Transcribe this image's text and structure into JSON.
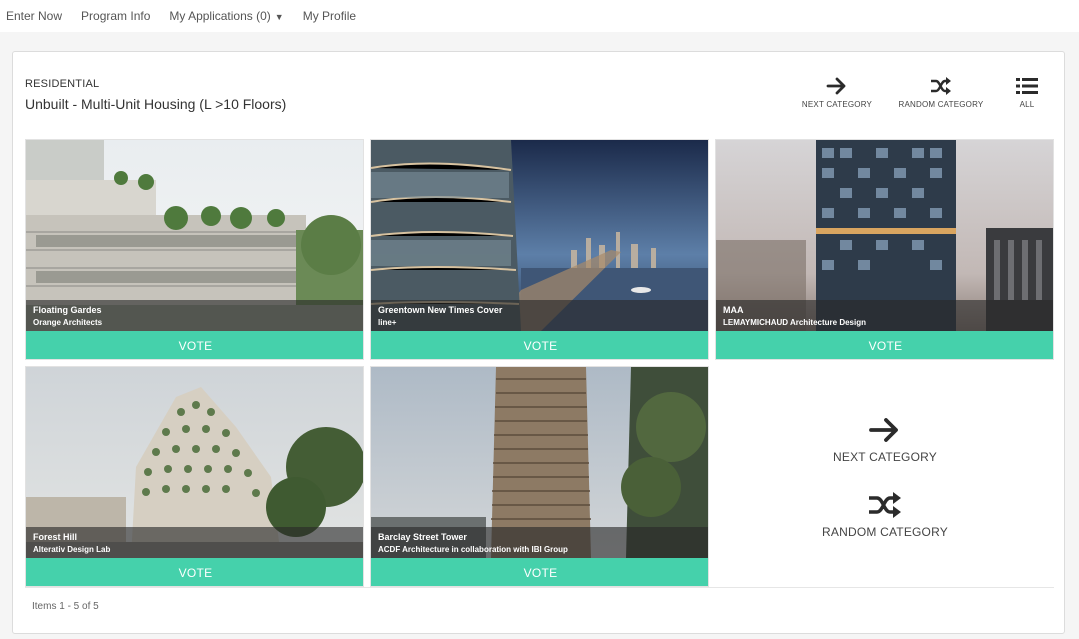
{
  "nav": {
    "enter_now": "Enter Now",
    "program_info": "Program Info",
    "my_applications": "My Applications (0)",
    "my_profile": "My Profile"
  },
  "category": {
    "label": "RESIDENTIAL",
    "title": "Unbuilt - Multi-Unit Housing (L >10 Floors)"
  },
  "toolbar": {
    "next_category": "NEXT CATEGORY",
    "random_category": "RANDOM CATEGORY",
    "all": "ALL"
  },
  "entries": [
    {
      "title": "Floating Gardes",
      "firm": "Orange Architects",
      "vote": "VOTE"
    },
    {
      "title": "Greentown New Times Cover",
      "firm": "line+",
      "vote": "VOTE"
    },
    {
      "title": "MAA",
      "firm": "LEMAYMICHAUD Architecture Design",
      "vote": "VOTE"
    },
    {
      "title": "Forest Hill",
      "firm": "Alterativ Design Lab",
      "vote": "VOTE"
    },
    {
      "title": "Barclay Street Tower",
      "firm": "ACDF Architecture in collaboration with IBI Group",
      "vote": "VOTE"
    }
  ],
  "side_actions": {
    "next_category": "NEXT CATEGORY",
    "random_category": "RANDOM CATEGORY"
  },
  "pagination": {
    "items_label": "Items 1 - 5 of 5"
  },
  "colors": {
    "vote_button": "#45d1ab",
    "caption_overlay": "#282828"
  },
  "icons": {
    "next": "arrow-right-icon",
    "random": "shuffle-icon",
    "all": "list-icon",
    "dropdown": "caret-down-icon"
  }
}
